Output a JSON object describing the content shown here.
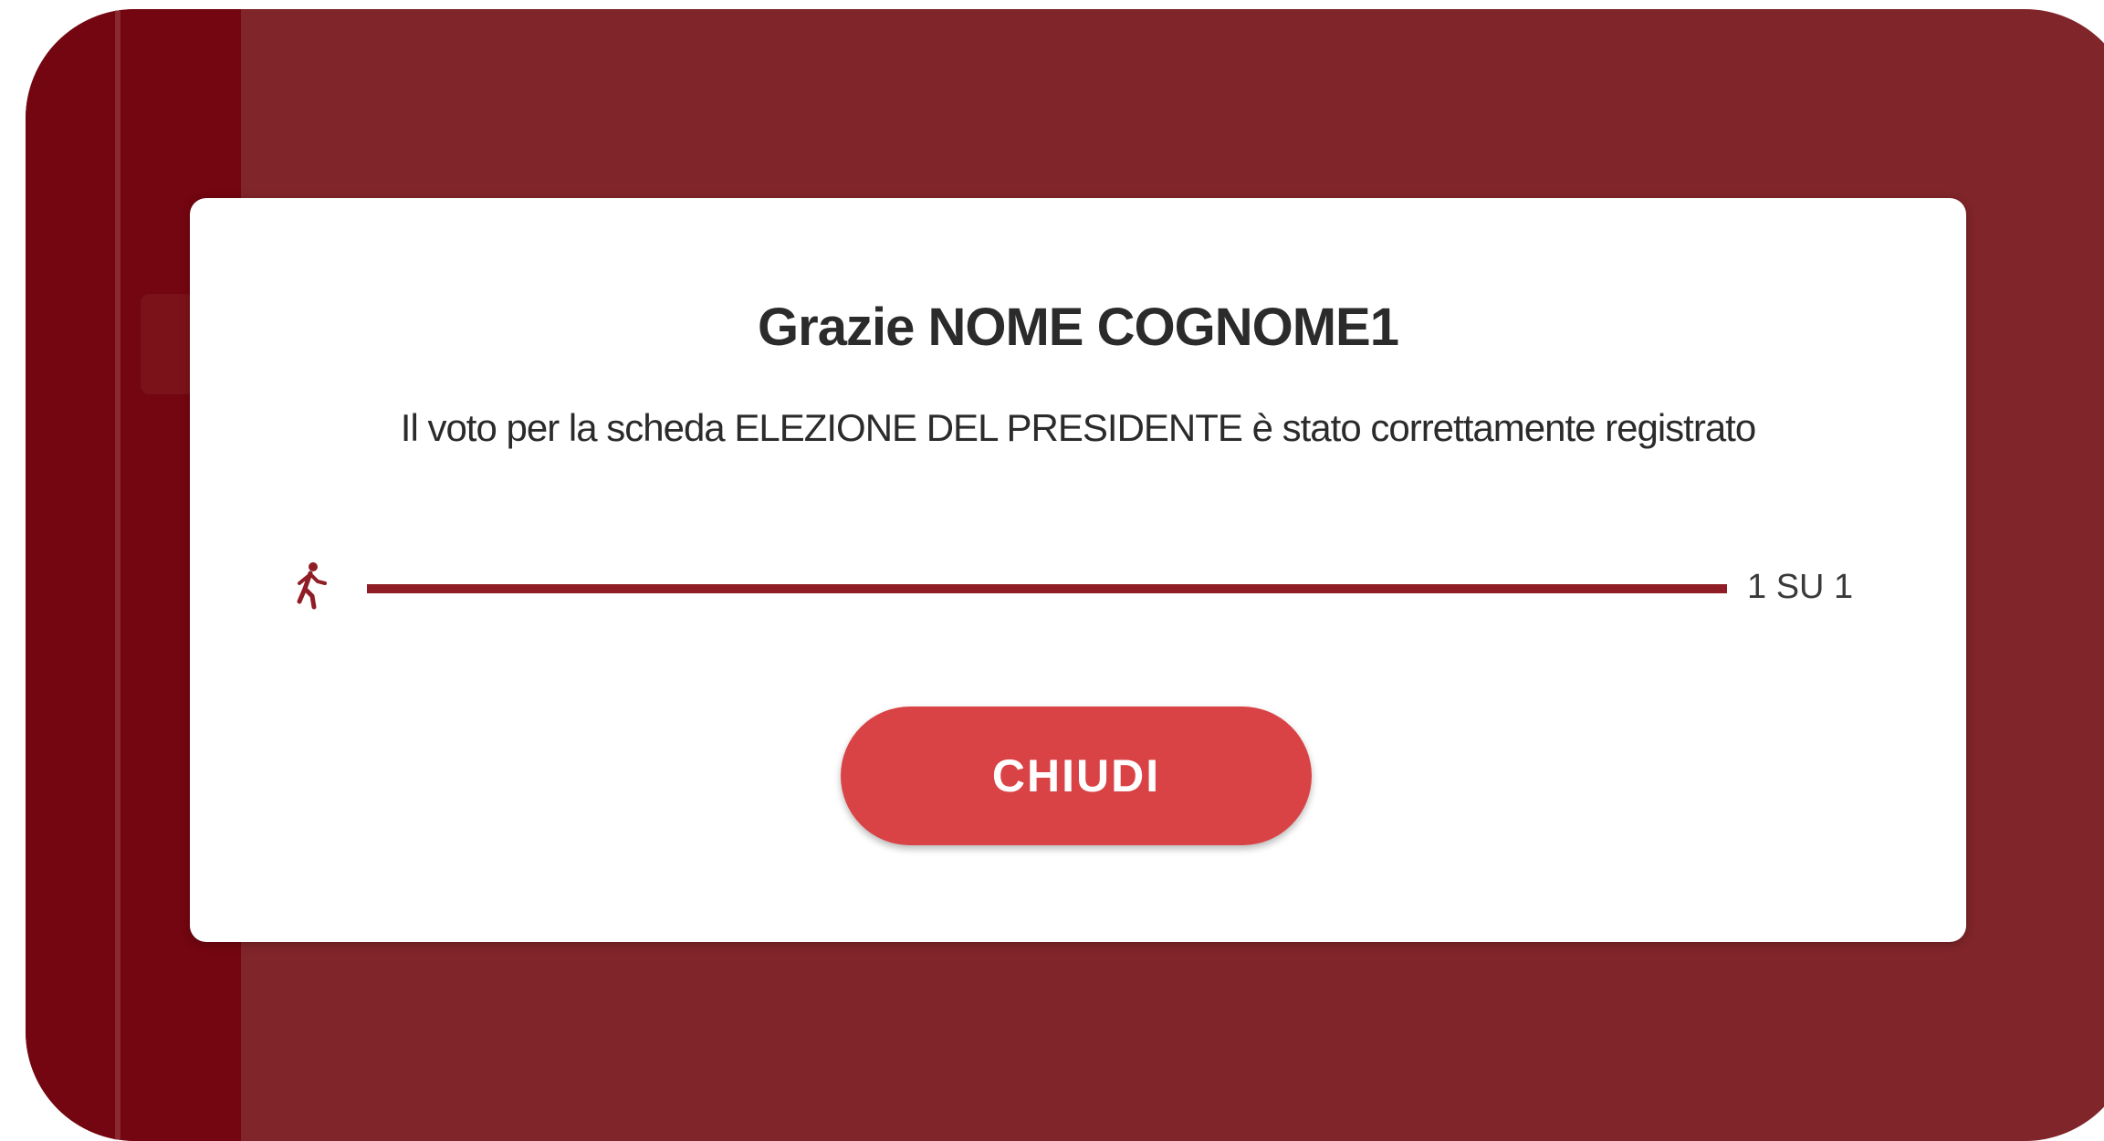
{
  "modal": {
    "title": "Grazie NOME COGNOME1",
    "message": "Il voto per la scheda ELEZIONE DEL PRESIDENTE è stato correttamente registrato",
    "progress": {
      "icon": "walking-person-icon",
      "label": "1 SU 1",
      "current": 1,
      "total": 1,
      "fraction": 1.0
    },
    "close_label": "CHIUDI"
  },
  "colors": {
    "background": "#802529",
    "sidebar": "#730610",
    "accent": "#8f1d25",
    "button": "#d94345",
    "text": "#2b2b2b"
  }
}
